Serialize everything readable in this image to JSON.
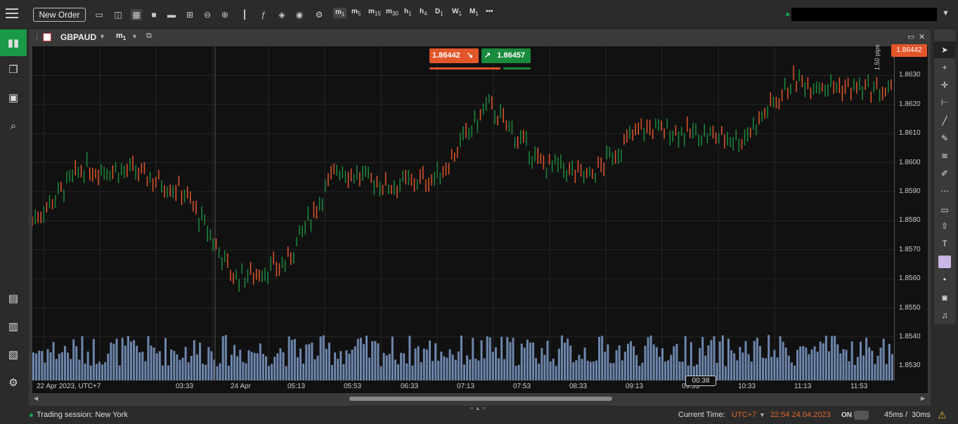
{
  "toolbar": {
    "new_order_label": "New Order",
    "timeframes": [
      {
        "main": "m",
        "sub": "1",
        "active": true
      },
      {
        "main": "m",
        "sub": "5"
      },
      {
        "main": "m",
        "sub": "15"
      },
      {
        "main": "m",
        "sub": "30"
      },
      {
        "main": "h",
        "sub": "1"
      },
      {
        "main": "h",
        "sub": "4"
      },
      {
        "main": "D",
        "sub": "1"
      },
      {
        "main": "W",
        "sub": "1"
      },
      {
        "main": "M",
        "sub": "1"
      }
    ],
    "more_label": "•••"
  },
  "chart_window": {
    "symbol": "GBPAUD",
    "timeframe_main": "m",
    "timeframe_sub": "1"
  },
  "quote": {
    "sell_price": "1.86442",
    "buy_price": "1.86457",
    "current_price_tag": "1.86442",
    "spread_label": "1.50 pips",
    "crosshair_time": "00:38"
  },
  "chart_data": {
    "type": "bar",
    "title": "",
    "yticks": [
      "1.8630",
      "1.8620",
      "1.8610",
      "1.8600",
      "1.8590",
      "1.8580",
      "1.8570",
      "1.8560",
      "1.8550",
      "1.8540",
      "1.8530"
    ],
    "xticks": [
      "22 Apr 2023, UTC+7",
      "03:33",
      "24 Apr",
      "05:13",
      "05:53",
      "06:33",
      "07:13",
      "07:53",
      "08:33",
      "09:13",
      "09:53",
      "10:33",
      "11:13",
      "11:53"
    ],
    "ylim": [
      1.8525,
      1.864
    ],
    "price_path": [
      {
        "t": "22 Apr 2023, UTC+7",
        "p": 1.858
      },
      {
        "t": "",
        "p": 1.8598
      },
      {
        "t": "03:33",
        "p": 1.8597
      },
      {
        "t": "",
        "p": 1.859
      },
      {
        "t": "24 Apr",
        "p": 1.856
      },
      {
        "t": "",
        "p": 1.8565
      },
      {
        "t": "05:13",
        "p": 1.8598
      },
      {
        "t": "05:53",
        "p": 1.8592
      },
      {
        "t": "06:33",
        "p": 1.8595
      },
      {
        "t": "07:13",
        "p": 1.862
      },
      {
        "t": "07:53",
        "p": 1.86
      },
      {
        "t": "08:33",
        "p": 1.8595
      },
      {
        "t": "09:13",
        "p": 1.8612
      },
      {
        "t": "09:53",
        "p": 1.861
      },
      {
        "t": "10:33",
        "p": 1.8608
      },
      {
        "t": "11:13",
        "p": 1.8628
      },
      {
        "t": "11:53",
        "p": 1.8626
      },
      {
        "t": "",
        "p": 1.8624
      }
    ],
    "bid_color": "#e2562a",
    "ask_color": "#1a8a3c",
    "volume_color": "#7e9bc9",
    "grid": true
  },
  "rightbar_tools": [
    "cursor-icon",
    "crosshair-icon",
    "move-icon",
    "measure-icon",
    "line-icon",
    "pen-icon",
    "fib-icon",
    "brush-icon",
    "ruler-icon",
    "rectangle-icon",
    "arrow-up-icon",
    "text-icon",
    "color-swatch",
    "dot-icon",
    "camera-icon",
    "alert-icon"
  ],
  "status": {
    "session": "Trading session: New York",
    "current_time_label": "Current Time:",
    "timezone": "UTC+7",
    "datetime": "22:54 24.04.2023",
    "toggle_label": "ON",
    "latency": "45ms",
    "latency_sep": "/",
    "latency2": "30ms"
  }
}
